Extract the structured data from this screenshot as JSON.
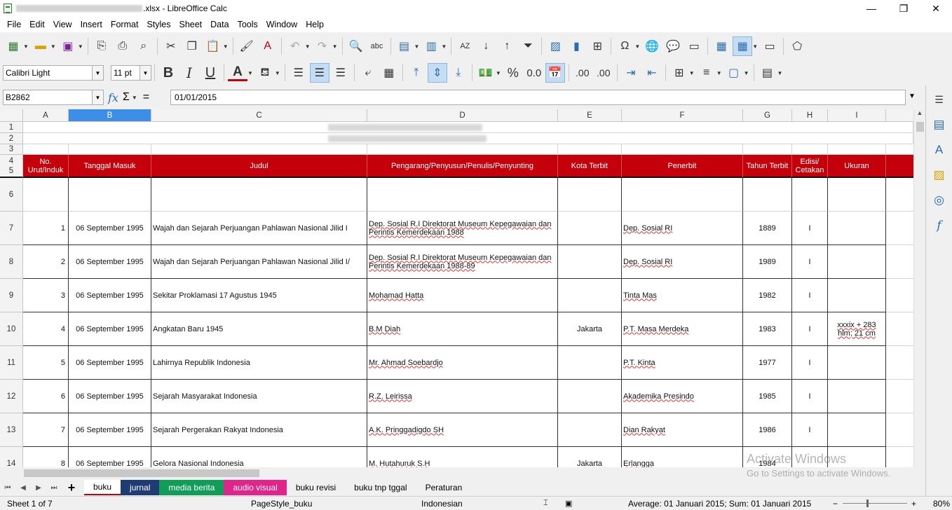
{
  "window": {
    "title": ".xlsx - LibreOffice Calc",
    "controls": [
      "—",
      "❐",
      "✕"
    ]
  },
  "menu": [
    "File",
    "Edit",
    "View",
    "Insert",
    "Format",
    "Styles",
    "Sheet",
    "Data",
    "Tools",
    "Window",
    "Help"
  ],
  "font": {
    "name": "Calibri Light",
    "size": "11 pt"
  },
  "formula": {
    "cell_ref": "B2862",
    "content": "01/01/2015",
    "sum_symbol": "Σ",
    "equals": "=",
    "fx": "fx"
  },
  "toolbar2_labels": {
    "bold": "B",
    "italic": "I",
    "underline": "U",
    "font_color": "A",
    "percent": "%",
    "decimal": "0.0",
    "add_decimal": ".00",
    "del_decimal": ".00"
  },
  "columns": [
    "A",
    "B",
    "C",
    "D",
    "E",
    "F",
    "G",
    "H",
    "I"
  ],
  "selected_column": "B",
  "header": {
    "row_labels": [
      "4",
      "5"
    ],
    "cells": [
      "No. Urut/Induk",
      "Tanggal Masuk",
      "Judul",
      "Pengarang/Penyusun/Penulis/Penyunting",
      "Kota Terbit",
      "Penerbit",
      "Tahun Terbit",
      "Edisi/ Cetakan",
      "Ukuran"
    ]
  },
  "top_rows": [
    "1",
    "2",
    "3"
  ],
  "empty_row": "6",
  "rows": [
    {
      "n": "7",
      "a": "1",
      "b": "06 September 1995",
      "c": "Wajah dan Sejarah Perjuangan Pahlawan Nasional Jilid I",
      "d": "Dep. Sosial R.I Direktorat Museum Kepegawaian dan Perintis Kemerdekaan 1988",
      "e": "",
      "f": "Dep. Sosial RI",
      "g": "1889",
      "h": "I",
      "i": ""
    },
    {
      "n": "8",
      "a": "2",
      "b": "06 September 1995",
      "c": "Wajah dan Sejarah Perjuangan Pahlawan Nasional Jilid I/",
      "d": "Dep. Sosial R.I Direktorat Museum Kepegawaian dan Perintis Kemerdekaan 1988-89",
      "e": "",
      "f": "Dep. Sosial RI",
      "g": "1989",
      "h": "I",
      "i": ""
    },
    {
      "n": "9",
      "a": "3",
      "b": "06 September 1995",
      "c": "Sekitar Proklamasi 17 Agustus 1945",
      "d": "Mohamad Hatta",
      "e": "",
      "f": "Tinta Mas",
      "g": "1982",
      "h": "I",
      "i": ""
    },
    {
      "n": "10",
      "a": "4",
      "b": "06 September 1995",
      "c": "Angkatan Baru 1945",
      "d": "B.M Diah",
      "e": "Jakarta",
      "f": "P.T. Masa Merdeka",
      "g": "1983",
      "h": "I",
      "i": "xxxix + 283 hlm; 21 cm"
    },
    {
      "n": "11",
      "a": "5",
      "b": "06 September 1995",
      "c": "Lahirnya Republik Indonesia",
      "d": "Mr. Ahmad Soebardjo",
      "e": "",
      "f": "P.T. Kinta",
      "g": "1977",
      "h": "I",
      "i": ""
    },
    {
      "n": "12",
      "a": "6",
      "b": "06 September 1995",
      "c": "Sejarah Masyarakat Indonesia",
      "d": "R.Z. Leirissa",
      "e": "",
      "f": "Akademika Presindo",
      "g": "1985",
      "h": "I",
      "i": ""
    },
    {
      "n": "13",
      "a": "7",
      "b": "06 September 1995",
      "c": "Sejarah Pergerakan Rakyat Indonesia",
      "d": "A.K. Pringgadigdo SH",
      "e": "",
      "f": "Dian Rakyat",
      "g": "1986",
      "h": "I",
      "i": ""
    },
    {
      "n": "14",
      "a": "8",
      "b": "06 September 1995",
      "c": "Gelora Nasional Indonesia",
      "d": "M. Hutahuruk S.H",
      "e": "Jakarta",
      "f": "Erlangga",
      "g": "1984",
      "h": "",
      "i": ""
    }
  ],
  "sheet_tabs": [
    {
      "label": "buku",
      "bg": "#ffffff",
      "fg": "#000000",
      "active": true
    },
    {
      "label": "jurnal",
      "bg": "#1f3b73",
      "fg": "#ffffff"
    },
    {
      "label": "media berita",
      "bg": "#0f9d58",
      "fg": "#ffffff"
    },
    {
      "label": "audio visual",
      "bg": "#e0248a",
      "fg": "#ffffff"
    },
    {
      "label": "buku revisi",
      "bg": "#f0f0f0",
      "fg": "#000000"
    },
    {
      "label": "buku tnp tggal",
      "bg": "#f0f0f0",
      "fg": "#000000"
    },
    {
      "label": "Peraturan",
      "bg": "#f0f0f0",
      "fg": "#000000"
    }
  ],
  "add_sheet": "+",
  "watermark": {
    "line1": "Activate Windows",
    "line2": "Go to Settings to activate Windows."
  },
  "status": {
    "sheet": "Sheet 1 of 7",
    "page_style": "PageStyle_buku",
    "language": "Indonesian",
    "summary": "Average: 01 Januari 2015; Sum: 01 Januari 2015",
    "zoom_minus": "−",
    "zoom_plus": "+",
    "zoom": "80%"
  },
  "colors": {
    "header_red": "#c4000b",
    "selected_col": "#3c8ee6",
    "accent": "#2a6db5"
  }
}
